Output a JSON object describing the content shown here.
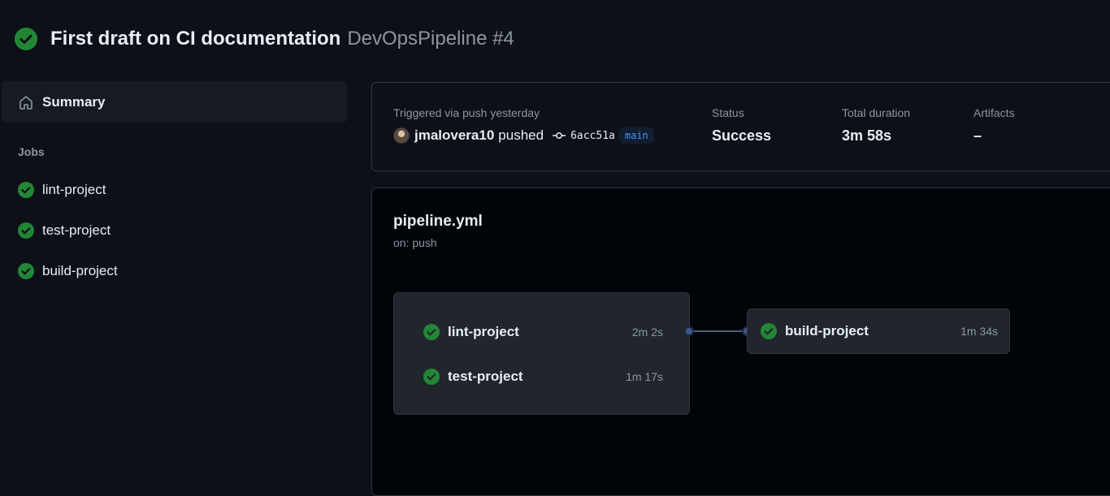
{
  "header": {
    "title": "First draft on CI documentation",
    "workflow": "DevOpsPipeline #4",
    "status_icon": "check-circle-fill-icon"
  },
  "sidebar": {
    "summary_label": "Summary",
    "jobs_heading": "Jobs",
    "jobs": [
      {
        "label": "lint-project"
      },
      {
        "label": "test-project"
      },
      {
        "label": "build-project"
      }
    ]
  },
  "run_summary": {
    "trigger_text": "Triggered via push yesterday",
    "actor": "jmalovera10",
    "action": "pushed",
    "commit": "6acc51a",
    "branch": "main",
    "status_label": "Status",
    "status_value": "Success",
    "duration_label": "Total duration",
    "duration_value": "3m 58s",
    "artifacts_label": "Artifacts",
    "artifacts_value": "–"
  },
  "pipeline": {
    "file": "pipeline.yml",
    "trigger": "on: push",
    "group_jobs": [
      {
        "name": "lint-project",
        "duration": "2m 2s"
      },
      {
        "name": "test-project",
        "duration": "1m 17s"
      }
    ],
    "next_job": {
      "name": "build-project",
      "duration": "1m 34s"
    }
  },
  "colors": {
    "background": "#0d1117",
    "success": "#238636",
    "text_muted": "#8d96a0",
    "branch": "#4493f8"
  }
}
